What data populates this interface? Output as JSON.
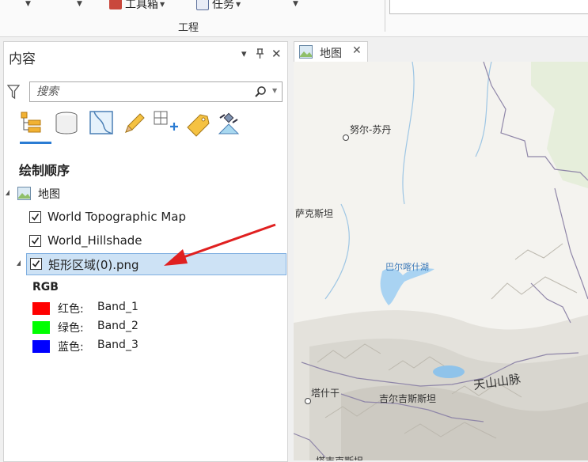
{
  "ribbon": {
    "toolbox_label": "工具箱",
    "tasks_label": "任务",
    "group_label": "工程"
  },
  "contents_pane": {
    "title": "内容",
    "pin_glyph": "▾",
    "search_placeholder": "搜索",
    "toolbar_icons": [
      "list-by-drawing-order-icon",
      "list-by-data-source-icon",
      "list-by-selection-icon",
      "list-by-editing-icon",
      "list-by-snapping-icon",
      "list-by-labeling-icon",
      "list-by-perspective-imagery-icon"
    ],
    "section_title": "绘制顺序",
    "map_node_label": "地图",
    "layers": [
      {
        "label": "World Topographic Map",
        "checked": true
      },
      {
        "label": "World_Hillshade",
        "checked": true
      },
      {
        "label": "矩形区域(0).png",
        "checked": true,
        "selected": true
      }
    ],
    "symbology_header": "RGB",
    "bands": [
      {
        "name": "红色:",
        "value": "Band_1",
        "color": "#ff0000"
      },
      {
        "name": "绿色:",
        "value": "Band_2",
        "color": "#00ff00"
      },
      {
        "name": "蓝色:",
        "value": "Band_3",
        "color": "#0000ff"
      }
    ]
  },
  "map_view": {
    "tab_label": "地图",
    "labels": {
      "city_1": "努尔-苏丹",
      "region_1": "萨克斯坦",
      "lake_1": "巴尔喀什湖",
      "range_1": "天山山脉",
      "city_2": "塔什干",
      "region_2": "吉尔吉斯斯坦",
      "region_3": "塔吉克斯坦"
    }
  },
  "colors": {
    "accent": "#2b7cd3",
    "selection": "#cde2f5",
    "annotation_arrow": "#e02020"
  }
}
